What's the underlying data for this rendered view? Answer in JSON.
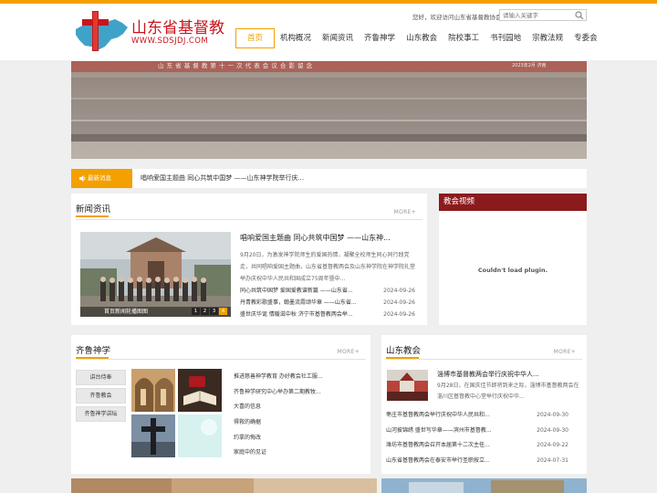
{
  "header": {
    "logo_name": "山东省基督教",
    "logo_url": "WWW.SDSJDJ.COM",
    "welcome": "您好，欢迎访问山东省基督教协会！",
    "search_placeholder": "请输入关键字",
    "nav": [
      "首页",
      "机构概况",
      "新闻资讯",
      "齐鲁神学",
      "山东教会",
      "院校事工",
      "书刊园地",
      "宗教法规",
      "专委会"
    ],
    "active_nav": "首页"
  },
  "banner": {
    "caption": "山 东 省 基 督 教 第 十 一 次 代 表 会 议 合 影 留 念",
    "date": "2023年2月 济南"
  },
  "ticker": {
    "badge": "最新消息",
    "text": "唱响爱国主题曲 同心共筑中国梦 ——山东神学院举行庆..."
  },
  "news": {
    "title": "新闻资讯",
    "more": "MORE+",
    "photo_caption": "首页新闻轮播图图",
    "pager": [
      "1",
      "2",
      "3",
      "4"
    ],
    "headline": "唱响爱国主题曲 同心共筑中国梦 ——山东神...",
    "summary": "9月20日，为激发神学院师生的爱国热情，凝聚全校师生同心同行践党走，共同唱响爱国主题曲，山东省基督教两会及山东神学院在神学院礼堂举办庆祝中华人民共和国成立75周年暨中...",
    "items": [
      {
        "title": "同心共筑中国梦 爱国爱教谱新篇 ——山东省...",
        "date": "2024-09-26"
      },
      {
        "title": "丹青教彩歌盛事，翰墨流霞颂华章 ——山东省...",
        "date": "2024-09-26"
      },
      {
        "title": "盛世庆华诞 情暖滋中秋 济宁市基督教两会举...",
        "date": "2024-09-26"
      }
    ]
  },
  "video": {
    "title": "教会视频",
    "message": "Couldn't load plugin."
  },
  "qilu": {
    "title": "齐鲁神学",
    "more": "MORE+",
    "buttons": [
      "讲台侍奉",
      "齐鲁教会",
      "齐鲁神学讲坛"
    ],
    "items": [
      "推进慈善神学教育 办好教会社工服...",
      "齐鲁神学研究中心举办第二期教牧...",
      "大喜的信息",
      "得救的确据",
      "约拿的悔改",
      "家庭中的见证"
    ]
  },
  "church": {
    "title": "山东教会",
    "more": "MORE+",
    "headline": "淄博市基督教两会举行庆祝中华人...",
    "summary": "9月28日，在国庆佳节即将到来之际，淄博市基督教两会在淄川区基督教中心堂举行庆祝中华...",
    "items": [
      {
        "title": "枣庄市基督教两会举行庆祝中华人民共和...",
        "date": "2024-09-30"
      },
      {
        "title": "山河披锦绣 盛世写华章——滨州市基督教...",
        "date": "2024-09-30"
      },
      {
        "title": "潍坊市基督教两会召开本届第十二次主任...",
        "date": "2024-09-22"
      },
      {
        "title": "山东省基督教两会在泰安市举行圣职按立...",
        "date": "2024-07-31"
      }
    ]
  },
  "colors": {
    "accent": "#f3a000",
    "brand_red": "#c9151e",
    "video_header": "#8b1a1d",
    "page_bg": "#efefef"
  },
  "icons": [
    "cross-shandong-logo-icon",
    "search-icon",
    "speaker-icon"
  ]
}
